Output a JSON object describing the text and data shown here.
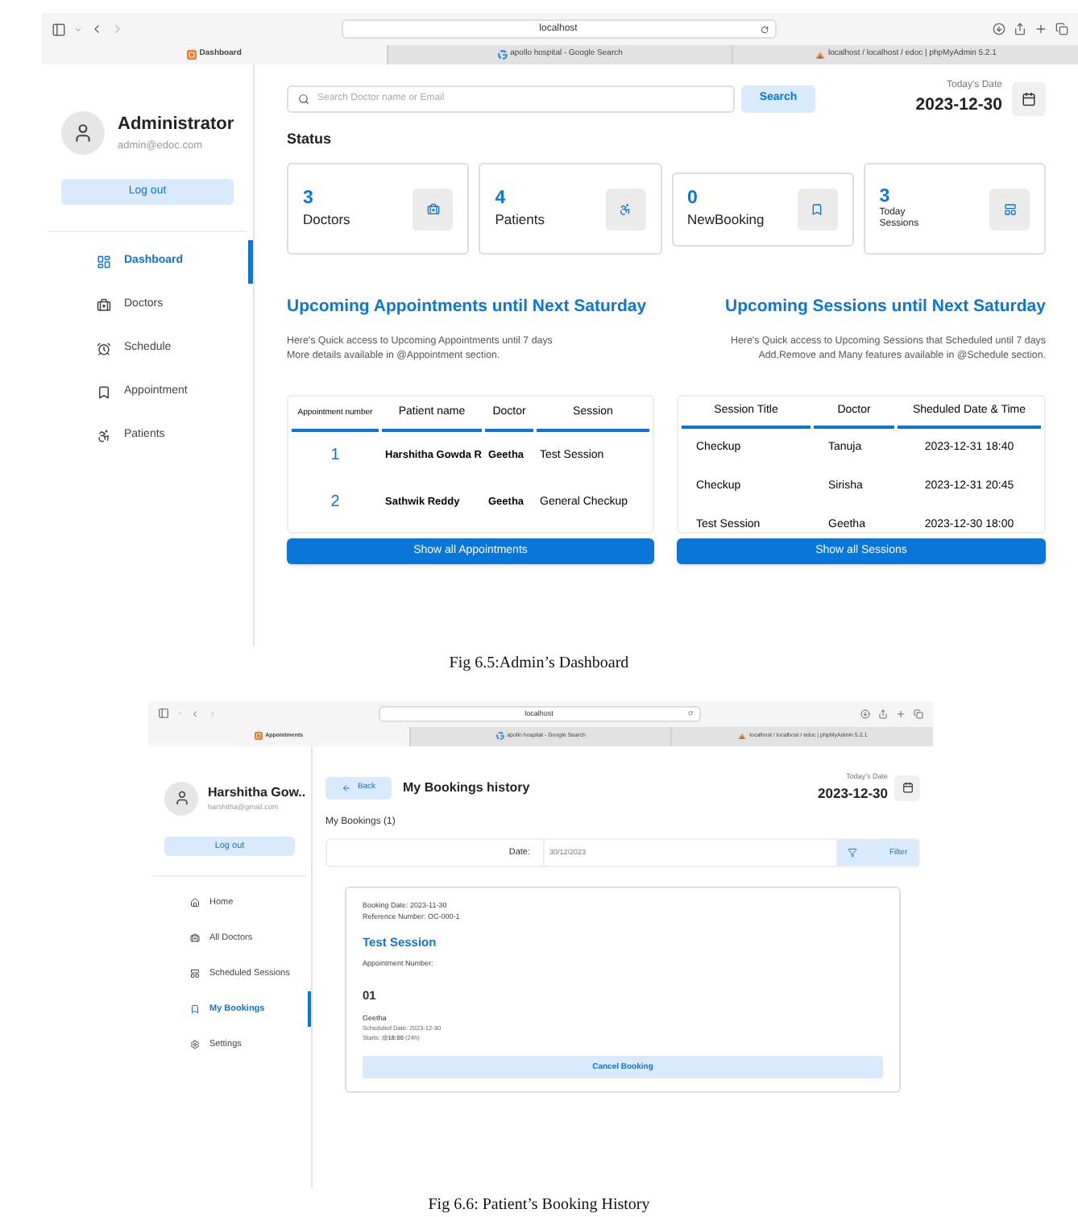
{
  "dashboard": {
    "browser": {
      "url": "localhost",
      "tabs": [
        {
          "label": "Dashboard",
          "selected": true
        },
        {
          "label": "apollo hospital - Google Search",
          "selected": false
        },
        {
          "label": "localhost / localhost / edoc | phpMyAdmin 5.2.1",
          "selected": false
        }
      ]
    },
    "user": {
      "name": "Administrator",
      "email": "admin@edoc.com"
    },
    "logout": "Log out",
    "nav": [
      {
        "label": "Dashboard",
        "selected": true
      },
      {
        "label": "Doctors",
        "selected": false
      },
      {
        "label": "Schedule",
        "selected": false
      },
      {
        "label": "Appointment",
        "selected": false
      },
      {
        "label": "Patients",
        "selected": false
      }
    ],
    "search": {
      "placeholder": "Search Doctor name or Email",
      "button": "Search"
    },
    "date_label": "Today's Date",
    "date": "2023-12-30",
    "status_title": "Status",
    "stats": [
      {
        "value": "3",
        "label": "Doctors"
      },
      {
        "value": "4",
        "label": "Patients"
      },
      {
        "value": "0",
        "label": "NewBooking"
      },
      {
        "value": "3",
        "label": "Today Sessions"
      }
    ],
    "appointments": {
      "title": "Upcoming Appointments until Next Saturday",
      "description": [
        "Here's Quick access to Upcoming Appointments until 7 days",
        "More details available in @Appointment section."
      ],
      "columns": [
        "Appointment number",
        "Patient name",
        "Doctor",
        "Session"
      ],
      "rows": [
        [
          "1",
          "Harshitha Gowda R",
          "Geetha",
          "Test Session"
        ],
        [
          "2",
          "Sathwik Reddy",
          "Geetha",
          "General Checkup"
        ]
      ],
      "button": "Show all Appointments"
    },
    "sessions": {
      "title": "Upcoming Sessions until Next Saturday",
      "description": [
        "Here's Quick access to Upcoming Sessions that Scheduled until 7 days",
        "Add,Remove and Many features available in @Schedule section."
      ],
      "columns": [
        "Session Title",
        "Doctor",
        "Sheduled Date & Time"
      ],
      "rows": [
        [
          "Checkup",
          "Tanuja",
          "2023-12-31 18:40"
        ],
        [
          "Checkup",
          "Sirisha",
          "2023-12-31 20:45"
        ],
        [
          "Test Session",
          "Geetha",
          "2023-12-30 18:00"
        ]
      ],
      "button": "Show all Sessions"
    },
    "caption": "Fig 6.5:Admin’s Dashboard"
  },
  "booking": {
    "browser": {
      "url": "localhost",
      "tabs": [
        {
          "label": "Appointments",
          "selected": true
        },
        {
          "label": "apollo hospital - Google Search",
          "selected": false
        },
        {
          "label": "localhost / localhost / edoc | phpMyAdmin 5.2.1",
          "selected": false
        }
      ]
    },
    "user": {
      "name": "Harshitha Gow..",
      "email": "harshitha@gmail.com"
    },
    "logout": "Log out",
    "nav": [
      {
        "label": "Home",
        "selected": false
      },
      {
        "label": "All Doctors",
        "selected": false
      },
      {
        "label": "Scheduled Sessions",
        "selected": false
      },
      {
        "label": "My Bookings",
        "selected": true
      },
      {
        "label": "Settings",
        "selected": false
      }
    ],
    "back": "Back",
    "title": "My Bookings history",
    "date_label": "Today's Date",
    "date": "2023-12-30",
    "count": "My Bookings (1)",
    "filter": {
      "label": "Date:",
      "value": "30/12/2023",
      "button": "Filter"
    },
    "card": {
      "booking_date": "Booking Date: 2023-11-30",
      "reference": "Reference Number: OC-000-1",
      "session": "Test Session",
      "appointment_label": "Appointment Number:",
      "appointment_number": "01",
      "doctor": "Geetha",
      "scheduled": "Scheduled Date: 2023-12-30",
      "starts": "Starts: **@18:00** (24h)",
      "button": "Cancel Booking"
    },
    "caption": "Fig 6.6: Patient’s Booking History"
  }
}
